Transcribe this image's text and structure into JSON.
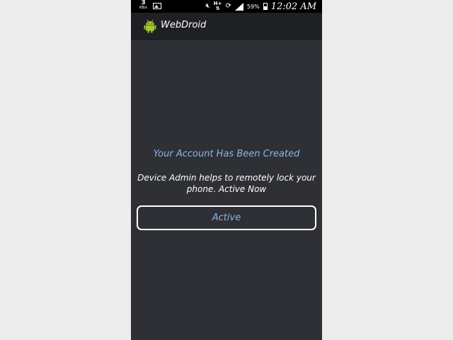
{
  "status_bar": {
    "data_speed_value": "3",
    "data_speed_unit": "KB/s",
    "network_type": "H+",
    "battery_percent": "59%",
    "time": "12:02 AM",
    "icons": [
      "image-icon",
      "mute-icon",
      "network-hplus-icon",
      "sync-icon",
      "signal-icon",
      "battery-icon"
    ]
  },
  "action_bar": {
    "app_title": "WebDroid",
    "app_icon": "android-icon",
    "icon_color": "#8bc34a"
  },
  "main": {
    "headline": "Your Account Has Been Created",
    "message": "Device Admin helps to remotely lock your phone. Active Now",
    "button_label": "Active"
  },
  "colors": {
    "background": "#2e3035",
    "accent": "#8fb3e6"
  }
}
